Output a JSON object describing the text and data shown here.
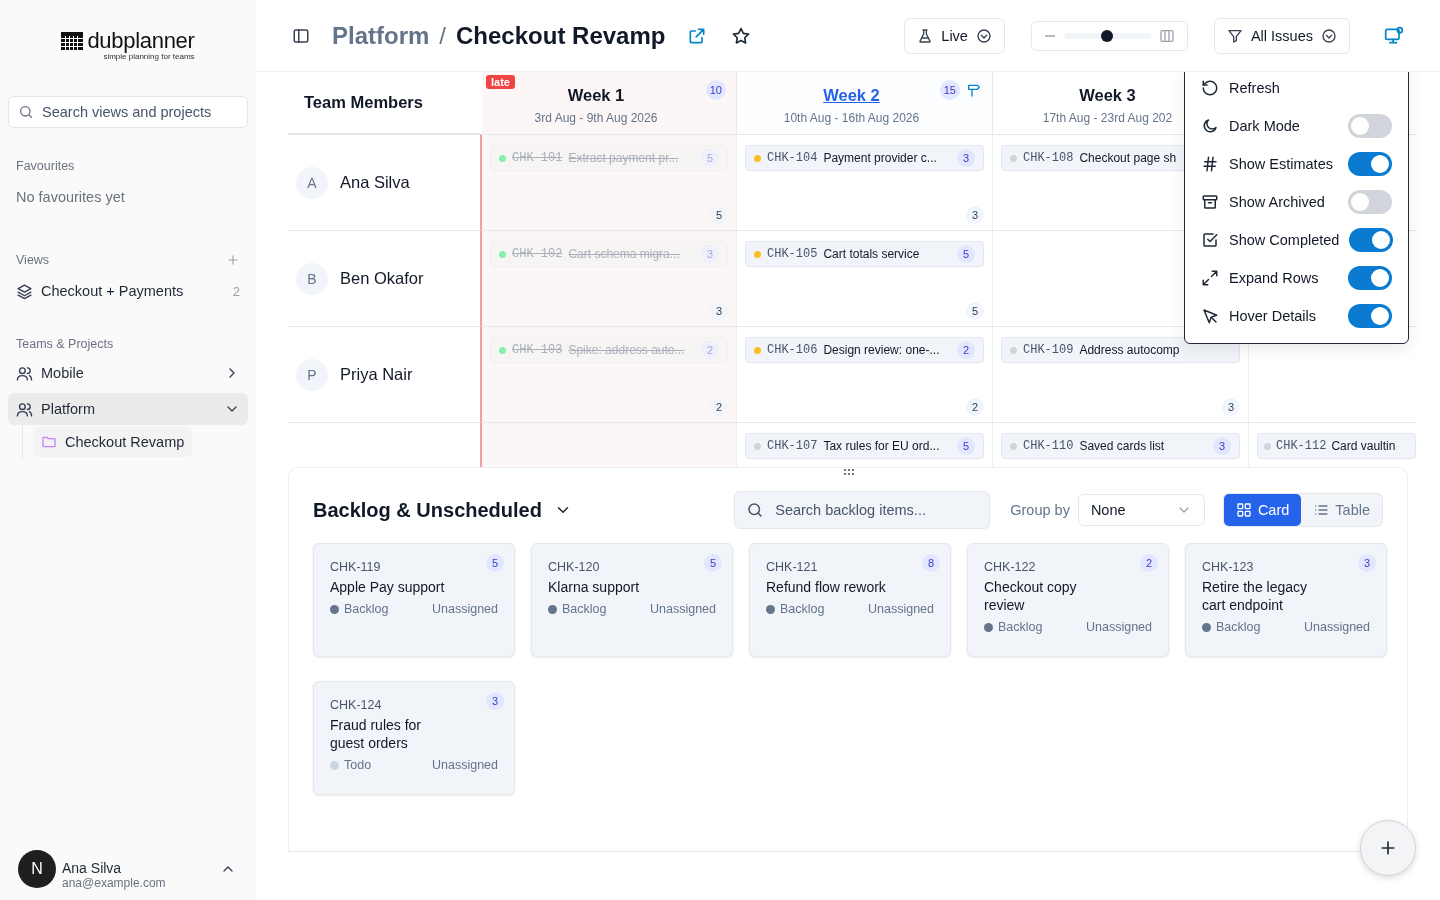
{
  "sidebar": {
    "logo": {
      "name": "dubplanner",
      "tagline": "simple planning for teams"
    },
    "search": {
      "placeholder": "Search views and projects"
    },
    "favourites": {
      "label": "Favourites",
      "empty": "No favourites yet"
    },
    "views": {
      "label": "Views",
      "items": [
        {
          "label": "Checkout + Payments",
          "count": "2",
          "selected": false
        }
      ]
    },
    "teams": {
      "label": "Teams & Projects",
      "items": [
        {
          "label": "Mobile",
          "expanded": false,
          "selected": false
        },
        {
          "label": "Platform",
          "expanded": true,
          "selected": true,
          "children": [
            {
              "label": "Checkout Revamp",
              "selected": true
            }
          ]
        }
      ]
    },
    "user": {
      "initial": "N",
      "name": "Ana Silva",
      "email": "ana@example.com"
    }
  },
  "header": {
    "parent": "Platform",
    "separator": "/",
    "title": "Checkout Revamp",
    "mode": "Live",
    "zoom": {
      "level": 0.5
    },
    "filter": "All Issues"
  },
  "board": {
    "members_heading": "Team Members",
    "weeks": [
      {
        "title": "Week 1",
        "dates": "3rd Aug - 9th Aug 2026",
        "count": "10",
        "badge": "late",
        "late": true,
        "current": false
      },
      {
        "title": "Week 2",
        "dates": "10th Aug - 16th Aug 2026",
        "count": "15",
        "late": false,
        "current": true
      },
      {
        "title": "Week 3",
        "dates": "17th Aug - 23rd Aug 202",
        "late": false,
        "current": false
      }
    ],
    "rows": [
      {
        "member": {
          "initial": "A",
          "name": "Ana Silva"
        },
        "cells": [
          {
            "issues": [
              {
                "id": "CHK-101",
                "title": "Extract payment pr...",
                "estimate": "5",
                "color": "#86efac",
                "done": true
              }
            ],
            "total": "5"
          },
          {
            "issues": [
              {
                "id": "CHK-104",
                "title": "Payment provider c...",
                "estimate": "3",
                "color": "#fbbf24",
                "done": false
              }
            ],
            "total": "3"
          },
          {
            "issues": [
              {
                "id": "CHK-108",
                "title": "Checkout page sh",
                "color": "#d1d5db",
                "done": false
              }
            ]
          },
          {}
        ]
      },
      {
        "member": {
          "initial": "B",
          "name": "Ben Okafor"
        },
        "cells": [
          {
            "issues": [
              {
                "id": "CHK-102",
                "title": "Cart schema migra...",
                "estimate": "3",
                "color": "#86efac",
                "done": true
              }
            ],
            "total": "3"
          },
          {
            "issues": [
              {
                "id": "CHK-105",
                "title": "Cart totals service",
                "estimate": "5",
                "color": "#fbbf24",
                "done": false
              }
            ],
            "total": "5"
          },
          {},
          {}
        ]
      },
      {
        "member": {
          "initial": "P",
          "name": "Priya Nair"
        },
        "cells": [
          {
            "issues": [
              {
                "id": "CHK-103",
                "title": "Spike: address auto...",
                "estimate": "2",
                "color": "#86efac",
                "done": true
              }
            ],
            "total": "2"
          },
          {
            "issues": [
              {
                "id": "CHK-106",
                "title": "Design review: one-...",
                "estimate": "2",
                "color": "#fbbf24",
                "done": false
              }
            ],
            "total": "2"
          },
          {
            "issues": [
              {
                "id": "CHK-109",
                "title": "Address autocomp",
                "color": "#d1d5db",
                "done": false
              }
            ],
            "total": "3"
          },
          {}
        ]
      },
      {
        "cells": [
          {},
          {
            "issues": [
              {
                "id": "CHK-107",
                "title": "Tax rules for EU ord...",
                "estimate": "5",
                "color": "#d1d5db",
                "done": false
              }
            ]
          },
          {
            "issues": [
              {
                "id": "CHK-110",
                "title": "Saved cards list",
                "estimate": "3",
                "color": "#d1d5db",
                "done": false
              }
            ]
          },
          {
            "issues": [
              {
                "id": "CHK-112",
                "title": "Card vaultin",
                "color": "#d1d5db",
                "done": false
              }
            ]
          }
        ]
      }
    ]
  },
  "menu": {
    "items": [
      {
        "kind": "action",
        "label": "Refresh"
      },
      {
        "kind": "toggle",
        "label": "Dark Mode",
        "on": false
      },
      {
        "kind": "toggle",
        "label": "Show Estimates",
        "on": true
      },
      {
        "kind": "toggle",
        "label": "Show Archived",
        "on": false
      },
      {
        "kind": "toggle",
        "label": "Show Completed",
        "on": true
      },
      {
        "kind": "toggle",
        "label": "Expand Rows",
        "on": true
      },
      {
        "kind": "toggle",
        "label": "Hover Details",
        "on": true
      }
    ]
  },
  "backlog": {
    "title": "Backlog & Unscheduled",
    "search": {
      "placeholder": "Search backlog items..."
    },
    "group_by": {
      "label": "Group by",
      "value": "None"
    },
    "views": [
      {
        "label": "Card",
        "selected": true
      },
      {
        "label": "Table",
        "selected": false
      }
    ],
    "cards": [
      {
        "id": "CHK-119",
        "title": "Apple Pay support",
        "estimate": "5",
        "status": "Backlog",
        "color": "#64748b",
        "assignee": "Unassigned"
      },
      {
        "id": "CHK-120",
        "title": "Klarna support",
        "estimate": "5",
        "status": "Backlog",
        "color": "#64748b",
        "assignee": "Unassigned"
      },
      {
        "id": "CHK-121",
        "title": "Refund flow rework",
        "estimate": "8",
        "status": "Backlog",
        "color": "#64748b",
        "assignee": "Unassigned"
      },
      {
        "id": "CHK-122",
        "title": "Checkout copy review",
        "estimate": "2",
        "status": "Backlog",
        "color": "#64748b",
        "assignee": "Unassigned"
      },
      {
        "id": "CHK-123",
        "title": "Retire the legacy cart endpoint",
        "estimate": "3",
        "status": "Backlog",
        "color": "#64748b",
        "assignee": "Unassigned"
      },
      {
        "id": "CHK-124",
        "title": "Fraud rules for guest orders",
        "estimate": "3",
        "status": "Todo",
        "color": "#cbd5e1",
        "assignee": "Unassigned"
      }
    ]
  }
}
